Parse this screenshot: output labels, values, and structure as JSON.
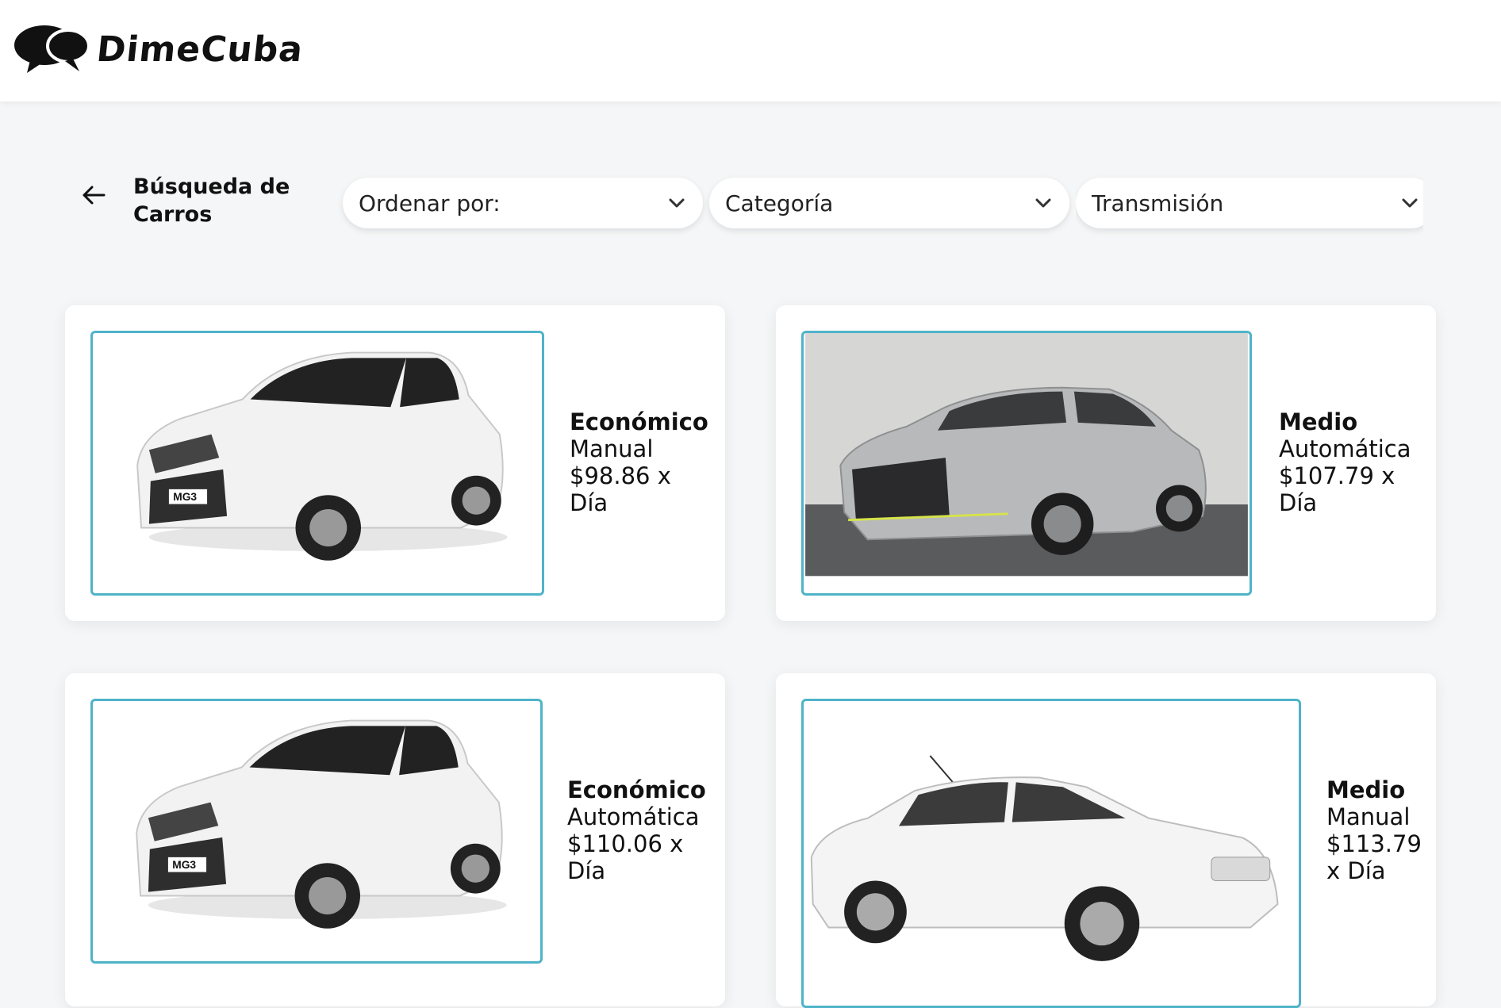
{
  "header": {
    "brand": "DimeCuba",
    "logo_icon": "speech-bubbles-icon"
  },
  "toolbar": {
    "back_icon": "arrow-left-icon",
    "title": "Búsqueda de Carros",
    "filters": [
      {
        "label": "Ordenar por:",
        "icon": "chevron-down-icon"
      },
      {
        "label": "Categoría",
        "icon": "chevron-down-icon"
      },
      {
        "label": "Transmisión",
        "icon": "chevron-down-icon"
      }
    ]
  },
  "cars": [
    {
      "category": "Económico",
      "transmission": "Manual",
      "price": "$98.86 x",
      "unit": "Día",
      "image": "white MG3 hatchback",
      "plate": "MG3"
    },
    {
      "category": "Medio",
      "transmission": "Automática",
      "price": "$107.79 x",
      "unit": "Día",
      "image": "silver sedan photo"
    },
    {
      "category": "Económico",
      "transmission": "Automática",
      "price": "$110.06 x",
      "unit": "Día",
      "image": "white MG3 hatchback",
      "plate": "MG3"
    },
    {
      "category": "Medio",
      "transmission": "Manual",
      "price": "$113.79",
      "unit": "x Día",
      "image": "white Peugeot sedan"
    }
  ],
  "colors": {
    "accent_border": "#4fb3c9",
    "background": "#f5f6f7"
  }
}
